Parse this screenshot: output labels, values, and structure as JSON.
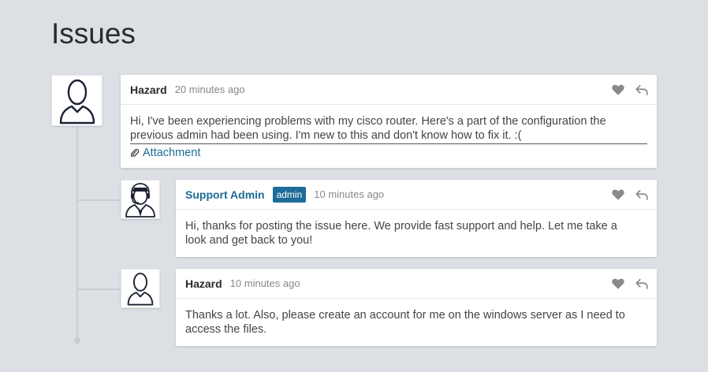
{
  "page": {
    "title": "Issues"
  },
  "comments": [
    {
      "author": "Hazard",
      "role_badge": "",
      "time": "20 minutes ago",
      "lines": [
        "Hi, I've been experiencing problems with my cisco router. Here's a part of the configuration the",
        "previous admin had been using. I'm new to this and don't know how to fix it. :("
      ],
      "attachment_label": "Attachment",
      "avatar_icon": "user-outline-icon"
    },
    {
      "author": "Support Admin",
      "role_badge": "admin",
      "time": "10 minutes ago",
      "lines": [
        "Hi, thanks for posting the issue here. We provide fast support and help. Let me take a",
        "look and get back to you!"
      ],
      "avatar_icon": "support-agent-headset-icon"
    },
    {
      "author": "Hazard",
      "role_badge": "",
      "time": "10 minutes ago",
      "lines": [
        "Thanks a lot. Also, please create an account for me on the windows server as I need to",
        "access the files."
      ],
      "avatar_icon": "user-outline-icon"
    }
  ],
  "colors": {
    "background": "#dcdfe3",
    "accent": "#1d6b98",
    "thread_line": "#c9ccd0",
    "icon_gray": "#8a8a8a"
  },
  "icons": {
    "like": "heart-icon",
    "reply": "reply-arrow-icon",
    "attachment": "paperclip-icon"
  }
}
